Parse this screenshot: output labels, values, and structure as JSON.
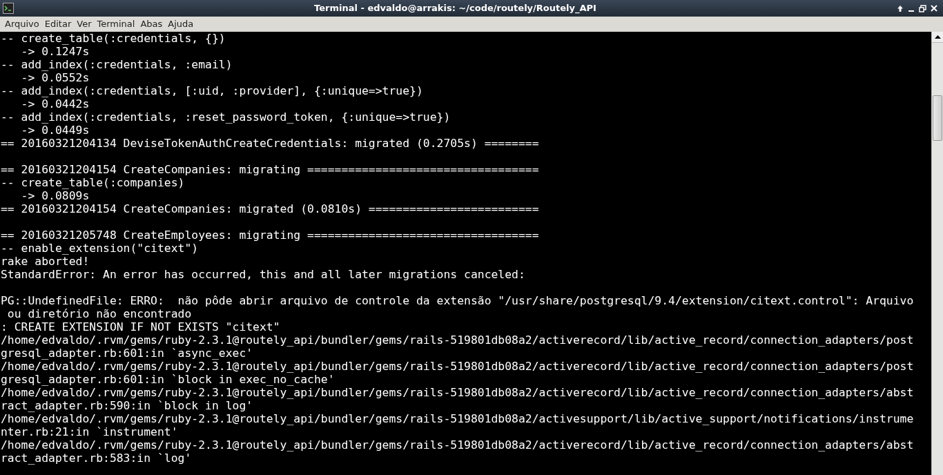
{
  "window": {
    "title": "Terminal - edvaldo@arrakis: ~/code/routely/Routely_API"
  },
  "menu": [
    "Arquivo",
    "Editar",
    "Ver",
    "Terminal",
    "Abas",
    "Ajuda"
  ],
  "terminal": {
    "lines": [
      {
        "kind": "text",
        "text": "-- create_table(:credentials, {})"
      },
      {
        "kind": "text",
        "text": "   -> 0.1247s"
      },
      {
        "kind": "text",
        "text": "-- add_index(:credentials, :email)"
      },
      {
        "kind": "text",
        "text": "   -> 0.0552s"
      },
      {
        "kind": "text",
        "text": "-- add_index(:credentials, [:uid, :provider], {:unique=>true})"
      },
      {
        "kind": "text",
        "text": "   -> 0.0442s"
      },
      {
        "kind": "text",
        "text": "-- add_index(:credentials, :reset_password_token, {:unique=>true})"
      },
      {
        "kind": "text",
        "text": "   -> 0.0449s"
      },
      {
        "kind": "text",
        "text": "== 20160321204134 DeviseTokenAuthCreateCredentials: migrated (0.2705s) ========"
      },
      {
        "kind": "blank"
      },
      {
        "kind": "text",
        "text": "== 20160321204154 CreateCompanies: migrating =================================="
      },
      {
        "kind": "text",
        "text": "-- create_table(:companies)"
      },
      {
        "kind": "text",
        "text": "   -> 0.0809s"
      },
      {
        "kind": "text",
        "text": "== 20160321204154 CreateCompanies: migrated (0.0810s) ========================="
      },
      {
        "kind": "blank"
      },
      {
        "kind": "text",
        "text": "== 20160321205748 CreateEmployees: migrating =================================="
      },
      {
        "kind": "text",
        "text": "-- enable_extension(\"citext\")"
      },
      {
        "kind": "text",
        "text": "rake aborted!"
      },
      {
        "kind": "text",
        "text": "StandardError: An error has occurred, this and all later migrations canceled:"
      },
      {
        "kind": "blank"
      },
      {
        "kind": "text",
        "text": "PG::UndefinedFile: ERRO:  não pôde abrir arquivo de controle da extensão \"/usr/share/postgresql/9.4/extension/citext.control\": Arquivo"
      },
      {
        "kind": "text",
        "text": " ou diretório não encontrado"
      },
      {
        "kind": "text",
        "text": ": CREATE EXTENSION IF NOT EXISTS \"citext\""
      },
      {
        "kind": "text",
        "text": "/home/edvaldo/.rvm/gems/ruby-2.3.1@routely_api/bundler/gems/rails-519801db08a2/activerecord/lib/active_record/connection_adapters/post"
      },
      {
        "kind": "text",
        "text": "gresql_adapter.rb:601:in `async_exec'"
      },
      {
        "kind": "text",
        "text": "/home/edvaldo/.rvm/gems/ruby-2.3.1@routely_api/bundler/gems/rails-519801db08a2/activerecord/lib/active_record/connection_adapters/post"
      },
      {
        "kind": "text",
        "text": "gresql_adapter.rb:601:in `block in exec_no_cache'"
      },
      {
        "kind": "text",
        "text": "/home/edvaldo/.rvm/gems/ruby-2.3.1@routely_api/bundler/gems/rails-519801db08a2/activerecord/lib/active_record/connection_adapters/abst"
      },
      {
        "kind": "text",
        "text": "ract_adapter.rb:590:in `block in log'"
      },
      {
        "kind": "text",
        "text": "/home/edvaldo/.rvm/gems/ruby-2.3.1@routely_api/bundler/gems/rails-519801db08a2/activesupport/lib/active_support/notifications/instrume"
      },
      {
        "kind": "text",
        "text": "nter.rb:21:in `instrument'"
      },
      {
        "kind": "text",
        "text": "/home/edvaldo/.rvm/gems/ruby-2.3.1@routely_api/bundler/gems/rails-519801db08a2/activerecord/lib/active_record/connection_adapters/abst"
      },
      {
        "kind": "text",
        "text": "ract_adapter.rb:583:in `log'"
      }
    ]
  }
}
